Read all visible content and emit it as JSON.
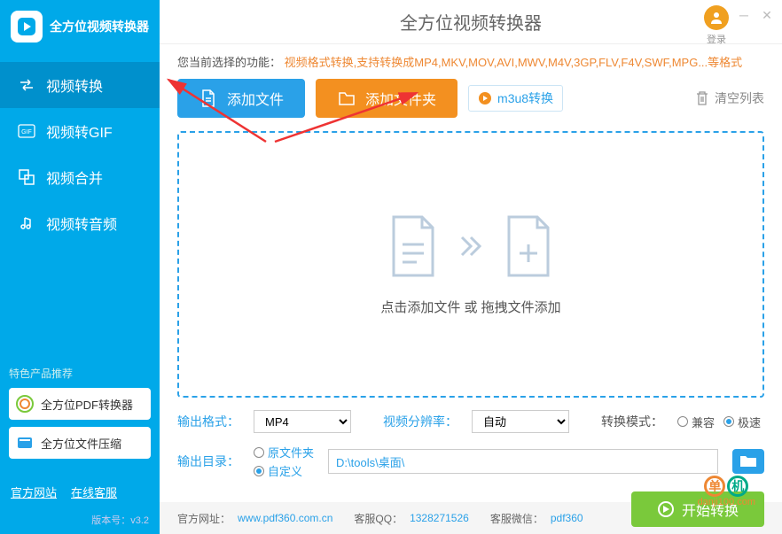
{
  "app": {
    "title": "全方位视频转换器",
    "logo_text": "全方位视频转换器"
  },
  "login": {
    "label": "登录"
  },
  "sidebar": {
    "items": [
      {
        "label": "视频转换"
      },
      {
        "label": "视频转GIF"
      },
      {
        "label": "视频合并"
      },
      {
        "label": "视频转音频"
      }
    ],
    "promo_title": "特色产品推荐",
    "promos": [
      {
        "label": "全方位PDF转换器"
      },
      {
        "label": "全方位文件压缩"
      }
    ],
    "links": {
      "site": "官方网站",
      "support": "在线客服"
    },
    "version_label": "版本号：",
    "version": "v3.2"
  },
  "content": {
    "func_label": "您当前选择的功能：",
    "func_desc": "视频格式转换,支持转换成MP4,MKV,MOV,AVI,MWV,M4V,3GP,FLV,F4V,SWF,MPG...等格式",
    "add_file": "添加文件",
    "add_folder": "添加文件夹",
    "m3u8": "m3u8转换",
    "clear": "清空列表",
    "drop_text": "点击添加文件 或 拖拽文件添加"
  },
  "options": {
    "format_label": "输出格式：",
    "format_value": "MP4",
    "resolution_label": "视频分辨率：",
    "resolution_value": "自动",
    "mode_label": "转换模式：",
    "mode_compat": "兼容",
    "mode_fast": "极速",
    "output_label": "输出目录：",
    "output_original": "原文件夹",
    "output_custom": "自定义",
    "output_path": "D:\\tools\\桌面\\"
  },
  "bottom": {
    "site_label": "官方网址：",
    "site": "www.pdf360.com.cn",
    "qq_label": "客服QQ：",
    "qq": "1328271526",
    "wechat_label": "客服微信：",
    "wechat": "pdf360",
    "convert": "开始转换"
  },
  "watermark": {
    "text": "danji100.com"
  }
}
